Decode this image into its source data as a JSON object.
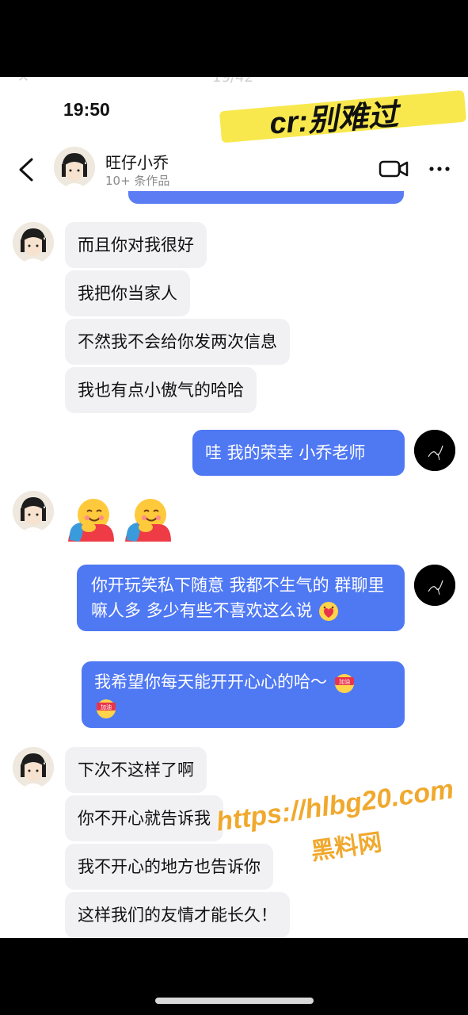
{
  "status_bar": {
    "time": "19:50",
    "ghost_text": "✕ 19/42"
  },
  "watermark_top": "cr:别难过",
  "header": {
    "name": "旺仔小乔",
    "subtitle": "10+ 条作品"
  },
  "messages": [
    {
      "side": "in",
      "text": "而且你对我很好"
    },
    {
      "side": "in",
      "text": "我把你当家人"
    },
    {
      "side": "in",
      "text": "不然我不会给你发两次信息"
    },
    {
      "side": "in",
      "text": "我也有点小傲气的哈哈"
    },
    {
      "side": "out",
      "text": "哇 我的荣幸 小乔老师"
    },
    {
      "side": "in",
      "emoji": [
        "hugging-face-emoji",
        "hugging-face-emoji"
      ]
    },
    {
      "side": "out",
      "text": "你开玩笑私下随意 我都不生气的 群聊里嘛人多 多少有些不喜欢这么说"
    },
    {
      "side": "out",
      "text": "我希望你每天能开开心心的哈～",
      "stickers": [
        "加油",
        "加油"
      ]
    },
    {
      "side": "in",
      "text": "下次不这样了啊"
    },
    {
      "side": "in",
      "text": "你不开心就告诉我"
    },
    {
      "side": "in",
      "text": "我不开心的地方也告诉你"
    },
    {
      "side": "in",
      "text": "这样我们的友情才能长久！"
    }
  ],
  "watermark_bottom": {
    "url": "https://hlbg20.com",
    "label": "黑料网"
  },
  "colors": {
    "outgoing": "#4f78f3",
    "incoming": "#f1f1f3",
    "watermark": "#f0a92e"
  }
}
